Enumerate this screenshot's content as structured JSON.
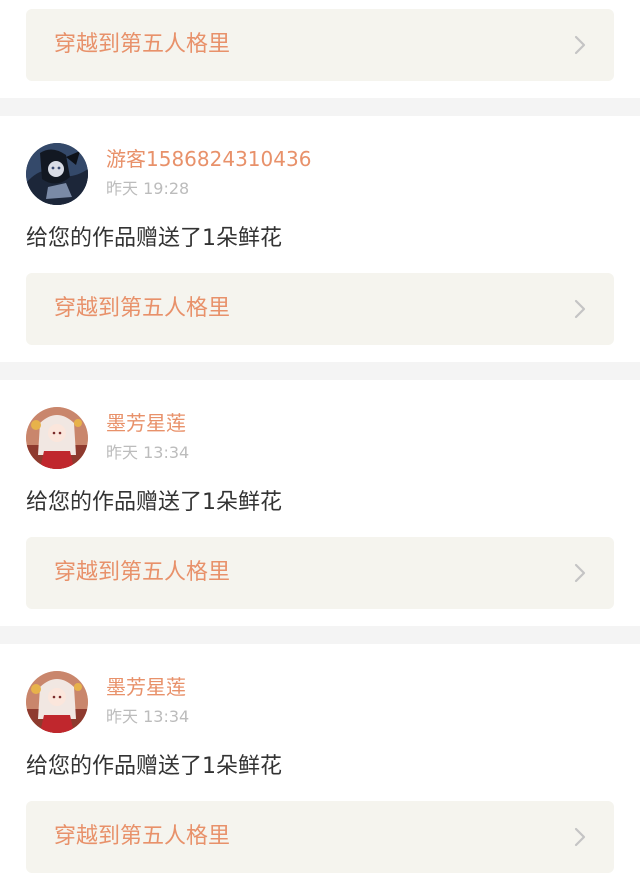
{
  "top_card": {
    "work_title": "穿越到第五人格里"
  },
  "notifications": [
    {
      "username": "游客1586824310436",
      "time": "昨天 19:28",
      "message": "给您的作品赠送了1朵鲜花",
      "work_title": "穿越到第五人格里",
      "avatar": "dark-anime-avatar"
    },
    {
      "username": "墨芳星莲",
      "time": "昨天 13:34",
      "message": "给您的作品赠送了1朵鲜花",
      "work_title": "穿越到第五人格里",
      "avatar": "red-anime-girl-avatar"
    },
    {
      "username": "墨芳星莲",
      "time": "昨天 13:34",
      "message": "给您的作品赠送了1朵鲜花",
      "work_title": "穿越到第五人格里",
      "avatar": "red-anime-girl-avatar"
    }
  ],
  "icons": {
    "chevron": "chevron-right-icon"
  },
  "colors": {
    "accent": "#e8916a",
    "link_bg": "#f5f4ee",
    "separator_bg": "#f4f4f4"
  }
}
